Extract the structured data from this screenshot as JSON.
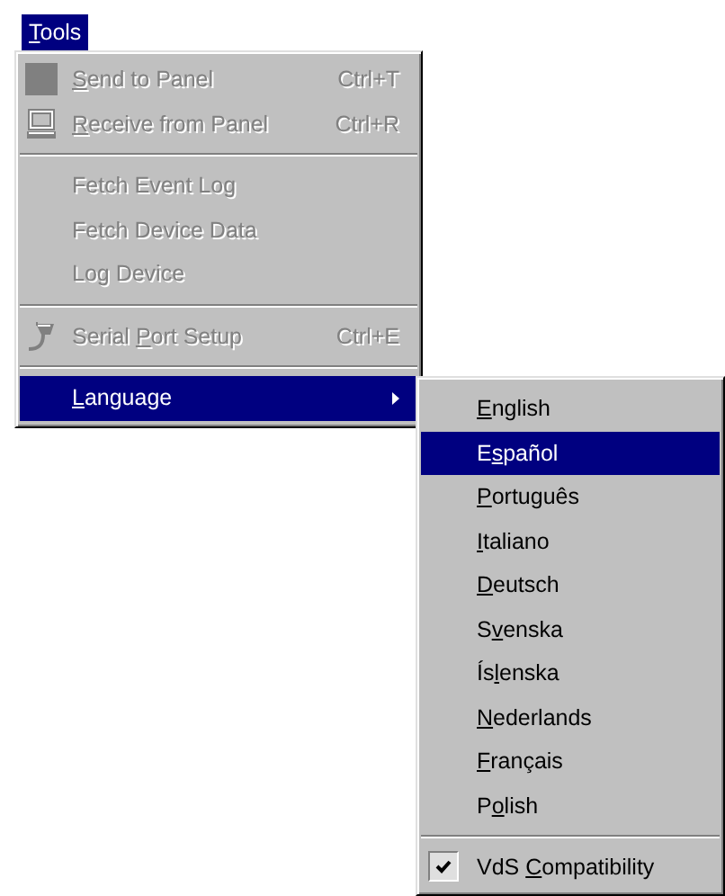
{
  "menu_bar": [
    {
      "label": {
        "key": "T",
        "after": "ools"
      },
      "selected": true
    }
  ],
  "tools_menu": [
    {
      "kind": "item",
      "label": {
        "key": "S",
        "after": "end to Panel"
      },
      "shortcut": "Ctrl+T",
      "disabled": true,
      "selected": false
    },
    {
      "kind": "item",
      "label": {
        "key": "R",
        "after": "eceive from Panel"
      },
      "shortcut": "Ctrl+R",
      "disabled": true,
      "selected": false
    },
    {
      "kind": "separator"
    },
    {
      "kind": "item",
      "label": {
        "before": "Fetch Event Log"
      },
      "disabled": true,
      "selected": false
    },
    {
      "kind": "item",
      "label": {
        "before": "Fetch Device Data"
      },
      "disabled": true,
      "selected": false
    },
    {
      "kind": "item",
      "label": {
        "before": "Log Device"
      },
      "disabled": true,
      "selected": false
    },
    {
      "kind": "separator"
    },
    {
      "kind": "item",
      "label": {
        "before": "Serial ",
        "key": "P",
        "after": "ort Setup"
      },
      "shortcut": "Ctrl+E",
      "disabled": true,
      "selected": false
    },
    {
      "kind": "separator"
    },
    {
      "kind": "submenu",
      "label": {
        "key": "L",
        "after": "anguage"
      },
      "disabled": false,
      "selected": true
    }
  ],
  "language_menu": [
    {
      "kind": "item",
      "label": {
        "key": "E",
        "after": "nglish"
      },
      "selected": false
    },
    {
      "kind": "item",
      "label": {
        "before": "E",
        "key": "s",
        "after": "pañol"
      },
      "selected": true
    },
    {
      "kind": "item",
      "label": {
        "key": "P",
        "after": "ortuguês"
      },
      "selected": false
    },
    {
      "kind": "item",
      "label": {
        "key": "I",
        "after": "taliano"
      },
      "selected": false
    },
    {
      "kind": "item",
      "label": {
        "key": "D",
        "after": "eutsch"
      },
      "selected": false
    },
    {
      "kind": "item",
      "label": {
        "before": "S",
        "key": "v",
        "after": "enska"
      },
      "selected": false
    },
    {
      "kind": "item",
      "label": {
        "before": "Ís",
        "key": "l",
        "after": "enska"
      },
      "selected": false
    },
    {
      "kind": "item",
      "label": {
        "key": "N",
        "after": "ederlands"
      },
      "selected": false
    },
    {
      "kind": "item",
      "label": {
        "key": "F",
        "after": "rançais"
      },
      "selected": false
    },
    {
      "kind": "item",
      "label": {
        "before": "P",
        "key": "o",
        "after": "lish"
      },
      "selected": false
    },
    {
      "kind": "separator"
    },
    {
      "kind": "check",
      "label": {
        "before": "VdS ",
        "key": "C",
        "after": "ompatibility"
      },
      "checked": true,
      "selected": false
    }
  ]
}
